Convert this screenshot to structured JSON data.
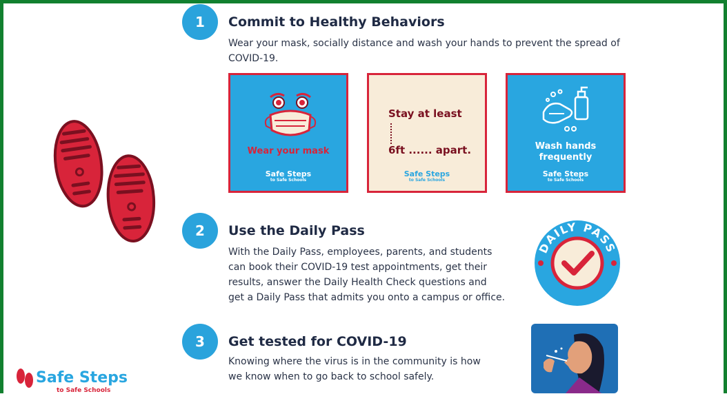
{
  "steps": [
    {
      "number": "1",
      "title": "Commit to Healthy Behaviors",
      "body_lines": [
        "Wear your mask, socially distance and wash your hands to prevent the spread of",
        "COVID-19."
      ]
    },
    {
      "number": "2",
      "title": "Use the Daily Pass",
      "body_lines": [
        "With the Daily Pass, employees, parents, and students",
        "can book their COVID-19 test appointments, get their",
        "results, answer the Daily Health Check questions and",
        "get a Daily Pass that admits you onto a campus or office."
      ]
    },
    {
      "number": "3",
      "title": "Get tested for COVID-19",
      "body_lines": [
        "Knowing where the virus is in the community is how",
        "we know when to go back to school safely."
      ]
    }
  ],
  "cards": {
    "mask": {
      "caption": "Wear your mask",
      "brand": "Safe Steps",
      "brand_sub": "to Safe Schools"
    },
    "distance": {
      "line1": "Stay at least",
      "line2": "6ft ...... apart.",
      "brand": "Safe Steps",
      "brand_sub": "to Safe Schools"
    },
    "wash": {
      "caption_line1": "Wash hands",
      "caption_line2": "frequently",
      "brand": "Safe Steps",
      "brand_sub": "to Safe Schools"
    }
  },
  "daily_pass_badge": {
    "text": "DAILY PASS"
  },
  "footer_logo": {
    "name": "Safe Steps",
    "tagline": "to Safe Schools"
  },
  "colors": {
    "frame_green": "#12802f",
    "step_blue": "#2aa3dc",
    "card_blue": "#29a6e0",
    "accent_red": "#d8243a",
    "cream": "#f8ecd9",
    "navy_text": "#1f2a44"
  },
  "icons": [
    "footprints-icon",
    "face-mask-icon",
    "hand-wash-icon",
    "daily-pass-check-icon",
    "nasal-swab-test-icon"
  ]
}
